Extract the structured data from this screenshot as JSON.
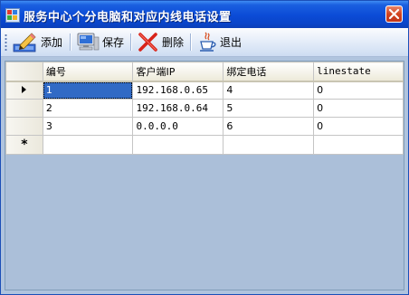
{
  "window": {
    "title": "服务中心个分电脑和对应内线电话设置"
  },
  "toolbar": {
    "add_label": "添加",
    "save_label": "保存",
    "delete_label": "删除",
    "exit_label": "退出"
  },
  "grid": {
    "columns": [
      "编号",
      "客户端IP",
      "绑定电话",
      "linestate"
    ],
    "rows": [
      [
        "1",
        "192.168.0.65",
        "4",
        "0"
      ],
      [
        "2",
        "192.168.0.64",
        "5",
        "0"
      ],
      [
        "3",
        "0.0.0.0",
        "6",
        "0"
      ]
    ],
    "new_row_marker": "*",
    "selection_color": "#316ac5"
  },
  "colors": {
    "titlebar": "#0b4bd6",
    "background": "#abbfd9",
    "close_button": "#d2431e"
  }
}
